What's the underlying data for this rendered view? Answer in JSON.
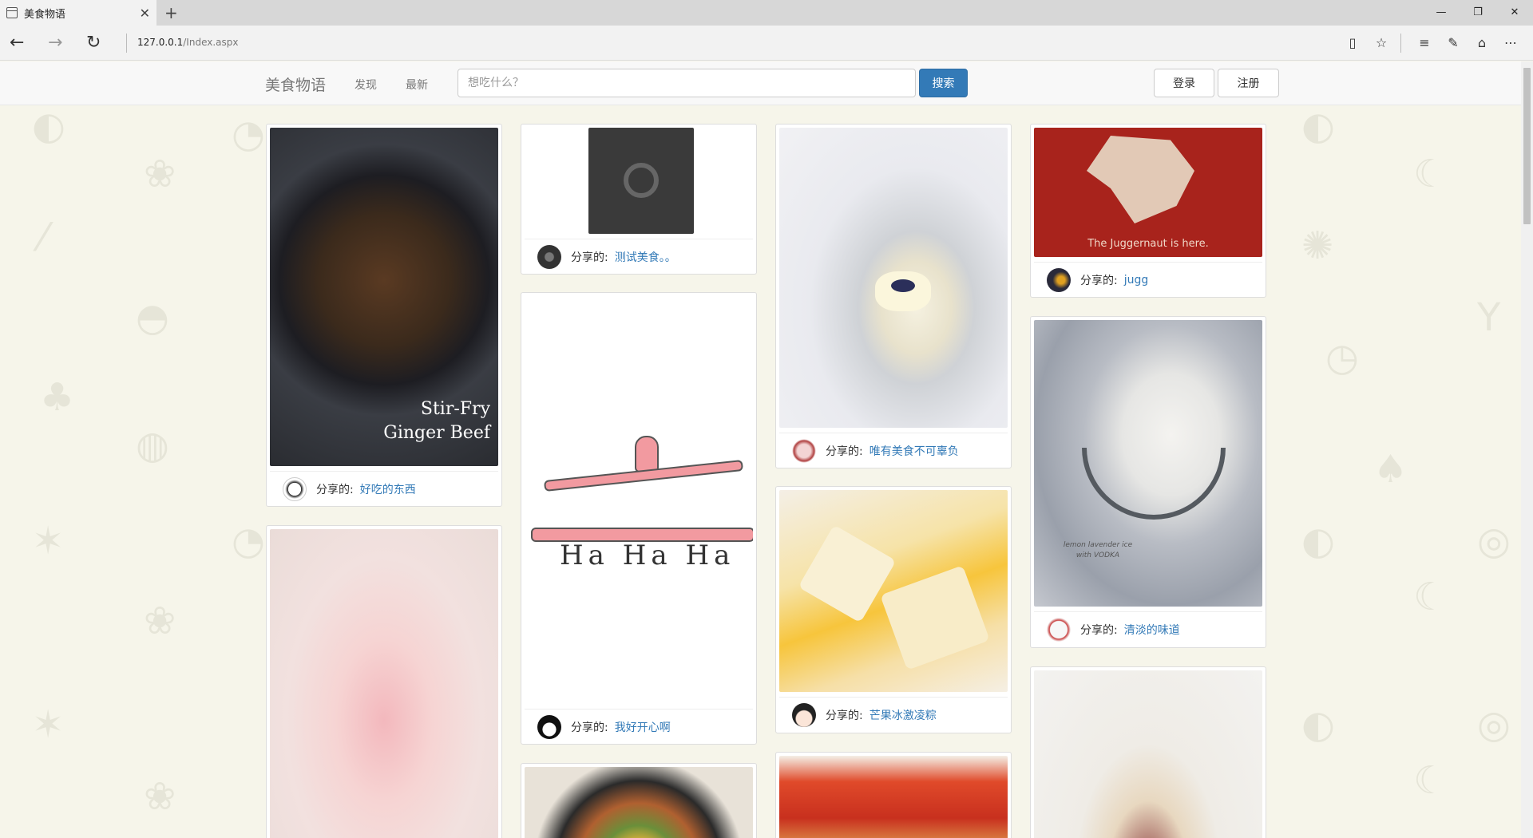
{
  "browser": {
    "tab_title": "美食物语",
    "tab_close": "✕",
    "new_tab": "+",
    "url_host": "127.0.0.1",
    "url_path": "/Index.aspx",
    "controls": [
      "—",
      "❐",
      "✕"
    ]
  },
  "site": {
    "brand": "美食物语",
    "nav": [
      "发现",
      "最新"
    ],
    "search_placeholder": "想吃什么？",
    "search_button": "搜索",
    "login_button": "登录",
    "register_button": "注册"
  },
  "posts": [
    {
      "shared_label": "分享的:",
      "title": "好吃的东西",
      "image_caption_1": "Stir-Fry",
      "image_caption_2": "Ginger Beef",
      "accent": "#3a3530"
    },
    {
      "shared_label": "分享的:",
      "title": "测试美食。。",
      "accent": "#3a3a3a"
    },
    {
      "shared_label": "分享的:",
      "title": "我好开心啊",
      "image_caption": "Ha Ha Ha",
      "accent": "#f29aa0"
    },
    {
      "shared_label": "分享的:",
      "title": "唯有美食不可辜负",
      "accent": "#e9e9ee"
    },
    {
      "shared_label": "分享的:",
      "title": "芒果冰激凌粽",
      "accent": "#f5c23a"
    },
    {
      "shared_label": "分享的:",
      "title": "jugg",
      "image_caption": "The Juggernaut is here.",
      "accent": "#a8231c"
    },
    {
      "shared_label": "分享的:",
      "title": "清淡的味道",
      "image_caption_1": "lemon lavender ice",
      "image_caption_2": "with VODKA",
      "accent": "#b8bcc4"
    }
  ]
}
